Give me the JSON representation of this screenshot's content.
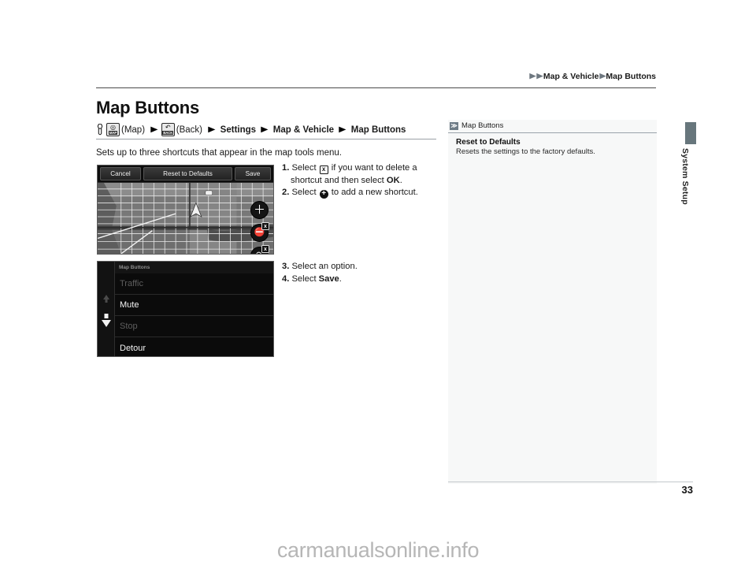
{
  "header": {
    "breadcrumb": [
      {
        "label": "Map & Vehicle"
      },
      {
        "label": "Map Buttons"
      }
    ],
    "arrow_glyph": "▶"
  },
  "page": {
    "title": "Map Buttons",
    "number": "33",
    "vertical_tab": "System Setup"
  },
  "nav_path": {
    "hand_icon": "finger-press-icon",
    "map_button": {
      "icon": "map-button-icon",
      "glyph": "◎",
      "caption": "MAP",
      "label": "(Map)"
    },
    "back_button": {
      "icon": "back-button-icon",
      "glyph": "↶",
      "caption": "BACK",
      "label": "(Back)"
    },
    "steps": [
      "Settings",
      "Map & Vehicle",
      "Map Buttons"
    ],
    "arrow_glyph": "▶"
  },
  "intro": "Sets up to three shortcuts that appear in the map tools menu.",
  "screenshot_map": {
    "toolbar": {
      "cancel": "Cancel",
      "reset": "Reset to Defaults",
      "save": "Save"
    },
    "fabs": [
      {
        "name": "add-shortcut-button",
        "glyph": "＋",
        "badge": null
      },
      {
        "name": "shortcut-stop-button",
        "glyph": "✖",
        "badge": "x"
      },
      {
        "name": "shortcut-detour-button",
        "glyph": "↪",
        "badge": "x"
      }
    ]
  },
  "screenshot_list": {
    "header": "Map Buttons",
    "rows": [
      {
        "label": "Traffic",
        "dim": true
      },
      {
        "label": "Mute",
        "dim": false
      },
      {
        "label": "Stop",
        "dim": true
      },
      {
        "label": "Detour",
        "dim": false
      }
    ],
    "scroll_up": "scroll-up-arrow",
    "scroll_down": "scroll-down-arrow"
  },
  "steps_a": {
    "s1_num": "1.",
    "s1_pre": "Select",
    "s1_mid": "if you want to delete a",
    "s1_cont_pre": "shortcut and then select",
    "s1_bold": "OK",
    "s1_end": ".",
    "s2_num": "2.",
    "s2_pre": "Select",
    "s2_post": "to add a new shortcut.",
    "icon_x": "x",
    "icon_plus": "+"
  },
  "steps_b": {
    "s3_num": "3.",
    "s3_text": "Select an option.",
    "s4_num": "4.",
    "s4_pre": "Select",
    "s4_bold": "Save",
    "s4_end": "."
  },
  "side_panel": {
    "icon": "double-chevron-icon",
    "icon_glyph": "≫",
    "title": "Map Buttons",
    "heading": "Reset to Defaults",
    "body": "Resets the settings to the factory defaults."
  },
  "watermark": "carmanualsonline.info",
  "colors": {
    "accent_tab": "#67767c",
    "panel_bg": "#f7f8f8",
    "rule": "#9aa3ab"
  }
}
